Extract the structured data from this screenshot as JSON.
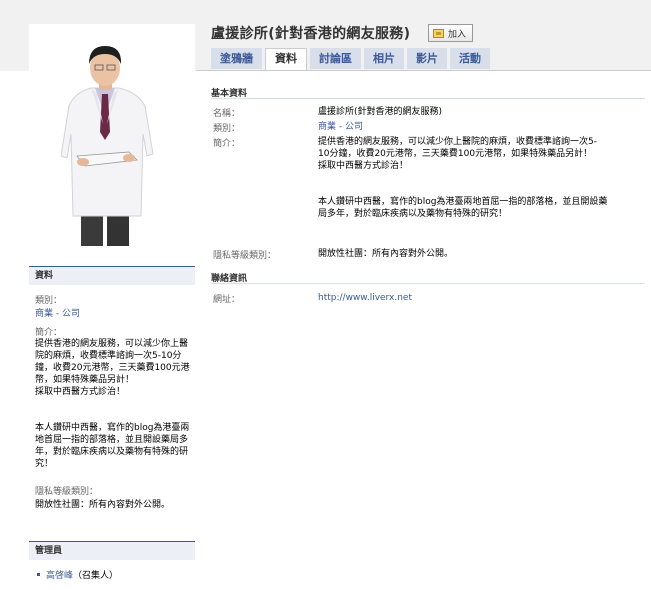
{
  "header": {
    "title": "盧援診所(針對香港的網友服務)",
    "join_label": "加入"
  },
  "tabs": [
    {
      "label": "塗鴉牆"
    },
    {
      "label": "資料"
    },
    {
      "label": "討論區"
    },
    {
      "label": "相片"
    },
    {
      "label": "影片"
    },
    {
      "label": "活動"
    }
  ],
  "basic": {
    "heading": "基本資料",
    "name_label": "名稱：",
    "name_value": "盧援診所(針對香港的網友服務)",
    "category_label": "類別：",
    "category_value": "商業 - 公司",
    "description_label": "簡介：",
    "description_value": "提供香港的網友服務，可以減少你上醫院的麻煩，收費標準諮詢一次5-10分鐘，收費20元港幣，三天藥費100元港幣，如果特殊藥品另計！\n採取中西醫方式診治！\n\n\n本人鑽研中西醫，寫作的blog為港臺兩地首屈一指的部落格，並且開設藥局多年，對於臨床疾病以及藥物有特殊的研究！",
    "privacy_label": "隱私等級類別：",
    "privacy_value": "開放性社團：所有內容對外公開。"
  },
  "contact": {
    "heading": "聯絡資訊",
    "website_label": "網址：",
    "website_value": "http://www.liverx.net"
  },
  "sidebar": {
    "info_heading": "資料",
    "category_label": "類別：",
    "category_value": "商業 - 公司",
    "description_label": "簡介：",
    "description_value": "提供香港的網友服務，可以減少你上醫院的麻煩，收費標準諮詢一次5-10分鐘，收費20元港幣，三天藥費100元港幣，如果特殊藥品另計！\n採取中西醫方式診治！\n\n\n本人鑽研中西醫，寫作的blog為港臺兩地首屈一指的部落格，並且開設藥局多年，對於臨床疾病以及藥物有特殊的研究！",
    "privacy_label": "隱私等級類別：",
    "privacy_value": "開放性社團：所有內容對外公開。",
    "admin_heading": "管理員",
    "admin_name": "高啓峰",
    "admin_role": "（召集人）"
  }
}
